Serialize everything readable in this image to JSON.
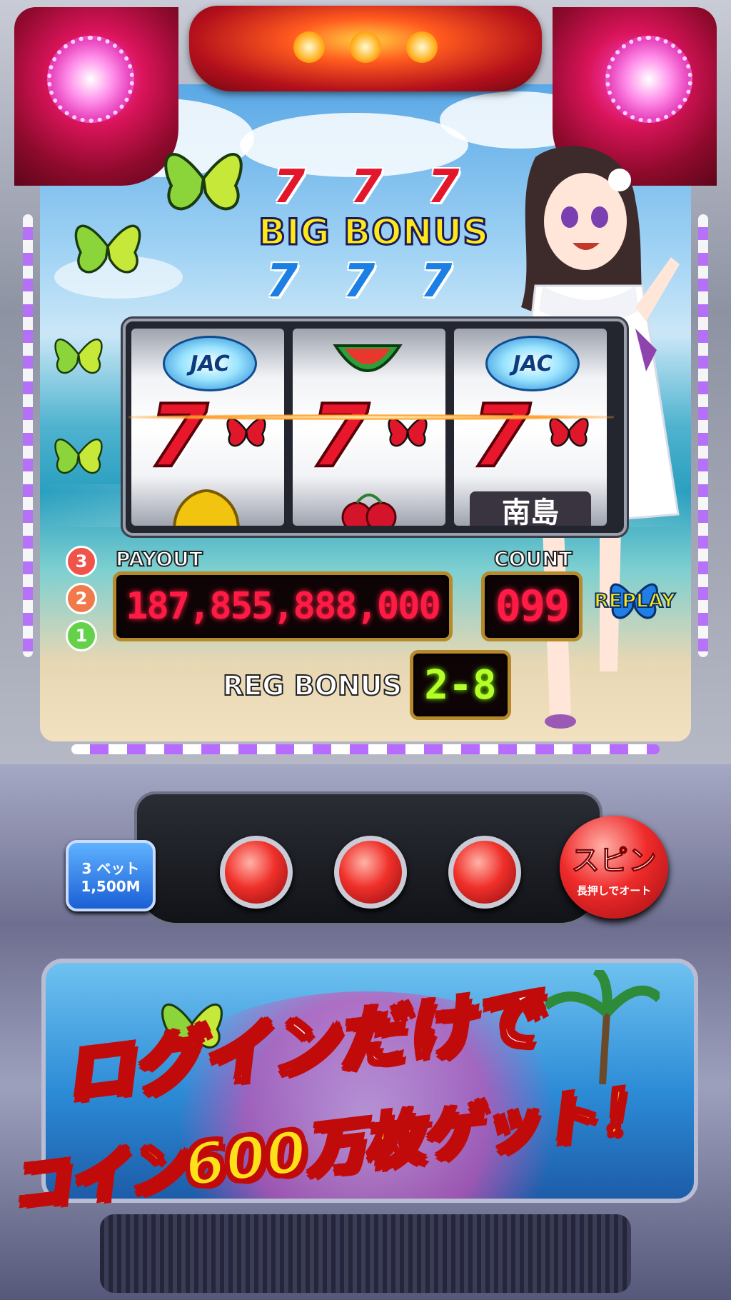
{
  "title": {
    "big_bonus": "BIG BONUS",
    "sevens_top": [
      "7",
      "7",
      "7"
    ],
    "sevens_bottom": [
      "7",
      "7",
      "7"
    ]
  },
  "reels": [
    {
      "top": "JAC",
      "middle": "7",
      "bottom": "bell"
    },
    {
      "top": "watermelon",
      "middle": "7",
      "bottom": "cherry"
    },
    {
      "top": "JAC",
      "middle": "7",
      "bottom": "南島"
    }
  ],
  "payout": {
    "label": "PAYOUT",
    "value": "187,855,888,000"
  },
  "count": {
    "label": "COUNT",
    "value": "099"
  },
  "reg_bonus": {
    "label": "REG BONUS",
    "value": "2-8"
  },
  "replay": {
    "label": "REPLAY"
  },
  "line_numbers": [
    "3",
    "2",
    "1"
  ],
  "controls": {
    "bet_line1": "3 ベット",
    "bet_line2": "1,500M",
    "spin_label": "スピン",
    "spin_hint": "長押しでオート"
  },
  "promo": {
    "line1": "ログインだけで",
    "line2": "コイン600万枚ゲット！"
  },
  "colors": {
    "accent_red": "#e4162c",
    "led_red": "#ff1b45",
    "led_green": "#b6ff28",
    "bonus_yellow": "#ffe81a"
  }
}
